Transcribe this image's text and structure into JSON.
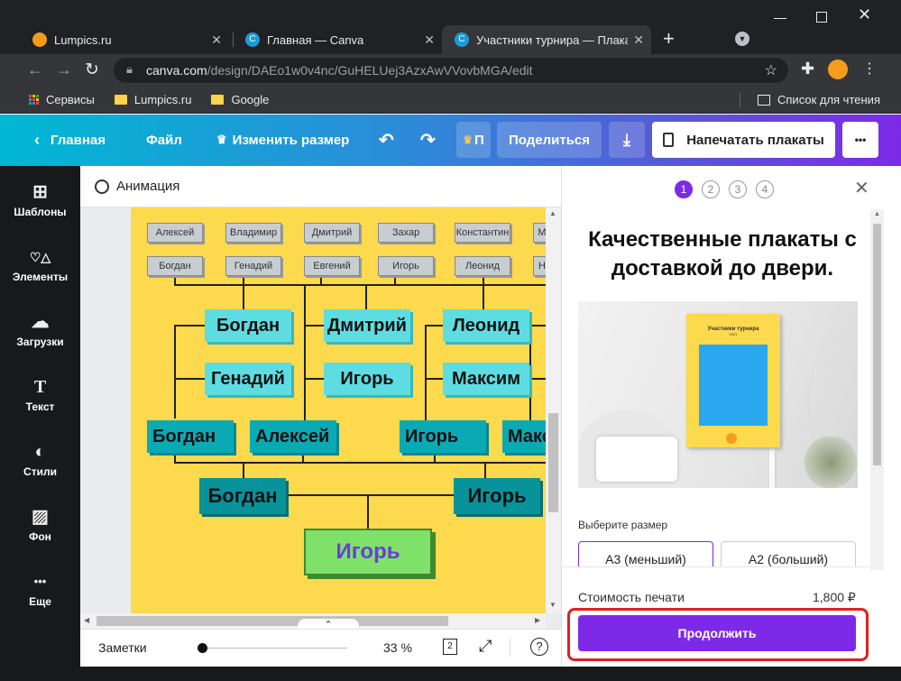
{
  "browser": {
    "tabs": [
      {
        "title": "Lumpics.ru"
      },
      {
        "title": "Главная — Canva"
      },
      {
        "title": "Участники турнира — Плакат"
      }
    ],
    "url_host": "canva.com",
    "url_path": "/design/DAEo1w0v4nc/GuHELUej3AzxAwVVovbMGA/edit",
    "bookmarks": [
      "Сервисы",
      "Lumpics.ru",
      "Google"
    ],
    "reading_list": "Список для чтения"
  },
  "header": {
    "home": "Главная",
    "file": "Файл",
    "resize": "Изменить размер",
    "share": "Поделиться",
    "print": "Напечатать плакаты",
    "more": "•••",
    "crown_letter": "П"
  },
  "sidebar": [
    {
      "label": "Шаблоны",
      "icon": "⊞"
    },
    {
      "label": "Элементы",
      "icon": "♡△"
    },
    {
      "label": "Загрузки",
      "icon": "☁"
    },
    {
      "label": "Текст",
      "icon": "T"
    },
    {
      "label": "Стили",
      "icon": "◐"
    },
    {
      "label": "Фон",
      "icon": "▨"
    },
    {
      "label": "Еще",
      "icon": "•••"
    }
  ],
  "animation_label": "Анимация",
  "poster": {
    "row1": [
      "Алексей",
      "Владимир",
      "Дмитрий",
      "Захар",
      "Константин",
      "М"
    ],
    "row2": [
      "Богдан",
      "Генадий",
      "Евгений",
      "Игорь",
      "Леонид",
      "Н"
    ],
    "quarter": [
      "Богдан",
      "Генадий",
      "Дмитрий",
      "Игорь",
      "Леонид",
      "Максим"
    ],
    "semi": [
      "Богдан",
      "Алексей",
      "Игорь",
      "Макс"
    ],
    "final": [
      "Богдан",
      "Игорь"
    ],
    "winner": "Игорь"
  },
  "bottombar": {
    "notes": "Заметки",
    "zoom": "33 %",
    "pages": "2",
    "zoom_level": 0.33
  },
  "panel": {
    "steps": [
      "1",
      "2",
      "3",
      "4"
    ],
    "title": "Качественные плакаты с доставкой до двери.",
    "photo_poster_title": "Участники турнира",
    "photo_poster_year": "2021",
    "size_label": "Выберите размер",
    "sizes": [
      "A3 (меньший)",
      "A2 (больший)"
    ],
    "price_label": "Стоимость печати",
    "price": "1,800 ₽",
    "continue": "Продолжить"
  },
  "colors": {
    "accent": "#7d2ae8",
    "poster_bg": "#fcd94d",
    "highlight": "#e02020"
  }
}
